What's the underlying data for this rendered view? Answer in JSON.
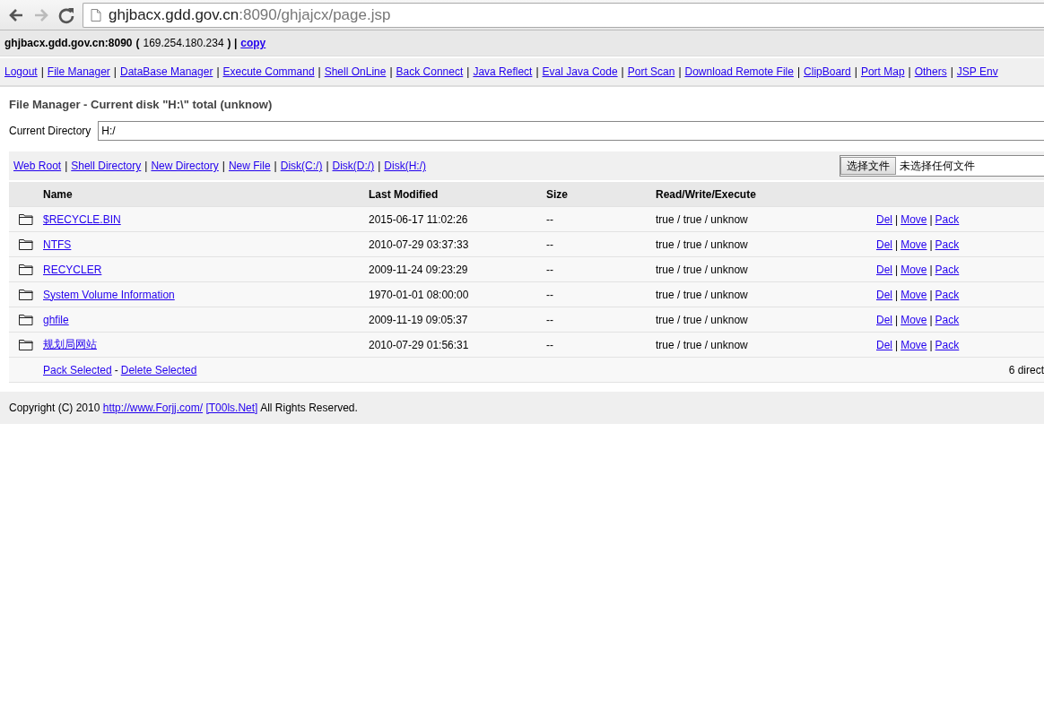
{
  "browser": {
    "url_host": "ghjbacx.gdd.gov.cn",
    "url_path": ":8090/ghjajcx/page.jsp"
  },
  "server_line": [
    {
      "kind": "bold",
      "text": "ghjbacx.gdd.gov.cn:8090"
    },
    {
      "kind": "bold",
      "text": "("
    },
    {
      "kind": "text",
      "text": "169.254.180.234"
    },
    {
      "kind": "bold",
      "text": ") |"
    },
    {
      "kind": "link",
      "text": "copy"
    }
  ],
  "nav": [
    "Logout",
    "|",
    "File Manager",
    "|",
    "DataBase Manager",
    "|",
    "Execute Command",
    "|",
    "Shell OnLine",
    "|",
    "Back Connect",
    "|",
    "Java Reflect",
    "|",
    "Eval Java Code",
    "|",
    "Port Scan",
    "|",
    "Download Remote File",
    "|",
    "ClipBoard",
    "|",
    "Port Map",
    "|",
    "Others",
    "|",
    "JSP Env"
  ],
  "title": "File Manager - Current disk \"H:\\\" total (unknow)",
  "current_directory": {
    "label": "Current Directory",
    "value": "H:/"
  },
  "toolbar": [
    "Web Root",
    "|",
    "Shell Directory",
    "|",
    "New Directory",
    "|",
    "New File",
    "|",
    "Disk(C:/)",
    "|",
    "Disk(D:/)",
    "|",
    "Disk(H:/)"
  ],
  "upload": {
    "button": "选择文件",
    "status": "未选择任何文件"
  },
  "table": {
    "columns": [
      "Name",
      "Last Modified",
      "Size",
      "Read/Write/Execute"
    ],
    "rows": [
      {
        "name": "$RECYCLE.BIN",
        "modified": "2015-06-17 11:02:26",
        "size": "--",
        "rwe": "true / true / unknow",
        "actions": [
          "Del",
          "|",
          "Move",
          "|",
          "Pack"
        ]
      },
      {
        "name": "NTFS",
        "modified": "2010-07-29 03:37:33",
        "size": "--",
        "rwe": "true / true / unknow",
        "actions": [
          "Del",
          "|",
          "Move",
          "|",
          "Pack"
        ]
      },
      {
        "name": "RECYCLER",
        "modified": "2009-11-24 09:23:29",
        "size": "--",
        "rwe": "true / true / unknow",
        "actions": [
          "Del",
          "|",
          "Move",
          "|",
          "Pack"
        ]
      },
      {
        "name": "System Volume Information",
        "modified": "1970-01-01 08:00:00",
        "size": "--",
        "rwe": "true / true / unknow",
        "actions": [
          "Del",
          "|",
          "Move",
          "|",
          "Pack"
        ]
      },
      {
        "name": "ghfile",
        "modified": "2009-11-19 09:05:37",
        "size": "--",
        "rwe": "true / true / unknow",
        "actions": [
          "Del",
          "|",
          "Move",
          "|",
          "Pack"
        ]
      },
      {
        "name": "规划局网站",
        "modified": "2010-07-29 01:56:31",
        "size": "--",
        "rwe": "true / true / unknow",
        "actions": [
          "Del",
          "|",
          "Move",
          "|",
          "Pack"
        ]
      }
    ],
    "footer_actions": [
      "Pack Selected",
      "-",
      "Delete Selected"
    ],
    "count": "6 direct"
  },
  "footer": [
    {
      "kind": "text",
      "text": "Copyright (C) 2010"
    },
    {
      "kind": "link",
      "text": "http://www.Forjj.com/"
    },
    {
      "kind": "link",
      "text": "[T00ls.Net]"
    },
    {
      "kind": "text",
      "text": "All Rights Reserved."
    }
  ]
}
